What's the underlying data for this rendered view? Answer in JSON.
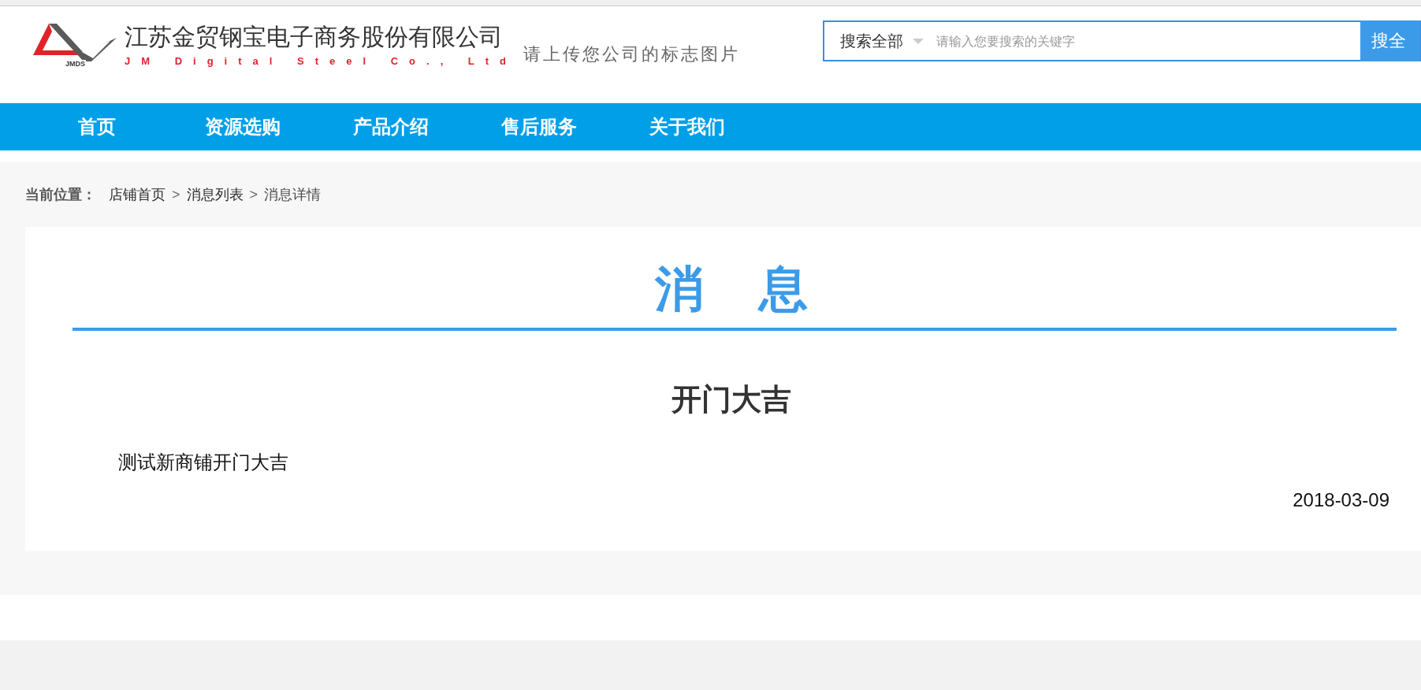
{
  "header": {
    "logo": {
      "mark_text": "JMDS",
      "company_name": "江苏金贸钢宝电子商务股份有限公司",
      "english_name": "JM Digital Steel Co., Ltd",
      "upload_hint": "请上传您公司的标志图片"
    },
    "search": {
      "scope": "搜索全部",
      "placeholder": "请输入您要搜索的关键字",
      "button": "搜全"
    }
  },
  "nav": [
    {
      "label": "首页"
    },
    {
      "label": "资源选购"
    },
    {
      "label": "产品介绍"
    },
    {
      "label": "售后服务"
    },
    {
      "label": "关于我们"
    }
  ],
  "breadcrumb": {
    "label": "当前位置：",
    "items": [
      {
        "kind": "link",
        "text": "店铺首页"
      },
      {
        "kind": "sep",
        "text": ">"
      },
      {
        "kind": "link",
        "text": "消息列表"
      },
      {
        "kind": "sep",
        "text": ">"
      },
      {
        "kind": "current",
        "text": "消息详情"
      }
    ]
  },
  "message": {
    "section_title": "消　息",
    "title": "开门大吉",
    "body": "测试新商铺开门大吉",
    "date": "2018-03-09"
  }
}
